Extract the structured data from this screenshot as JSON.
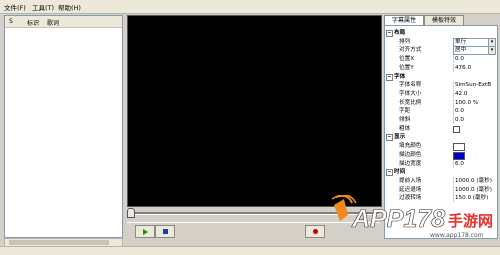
{
  "menu": [
    "文件(F)",
    "工具(T)",
    "帮助(H)"
  ],
  "list": {
    "columns": [
      "S",
      "标识",
      "歌词"
    ]
  },
  "controls": {
    "play": "play",
    "stop": "stop",
    "record": "record"
  },
  "tabs": [
    "字幕属性",
    "模板特效"
  ],
  "properties": [
    {
      "type": "category",
      "name": "布局"
    },
    {
      "type": "select",
      "name": "排列",
      "value": "单行"
    },
    {
      "type": "select",
      "name": "对齐方式",
      "value": "居中"
    },
    {
      "type": "text",
      "name": "位置X",
      "value": "0.0"
    },
    {
      "type": "text",
      "name": "位置Y",
      "value": "476.0"
    },
    {
      "type": "category",
      "name": "字体"
    },
    {
      "type": "text",
      "name": "字体名称",
      "value": "SimSun-ExtB"
    },
    {
      "type": "text",
      "name": "字体大小",
      "value": "42.0"
    },
    {
      "type": "text",
      "name": "长宽比例",
      "value": "100.0 %"
    },
    {
      "type": "text",
      "name": "字距",
      "value": "0.0"
    },
    {
      "type": "text",
      "name": "倾斜",
      "value": "0.0"
    },
    {
      "type": "checkbox",
      "name": "粗体",
      "value": ""
    },
    {
      "type": "category",
      "name": "显示"
    },
    {
      "type": "color",
      "name": "填充颜色",
      "value": "#ffffff"
    },
    {
      "type": "color",
      "name": "描边颜色",
      "value": "#0000cc"
    },
    {
      "type": "text",
      "name": "描边宽度",
      "value": "6.0"
    },
    {
      "type": "category",
      "name": "时间"
    },
    {
      "type": "text",
      "name": "提前入场",
      "value": "1000.0 (毫秒)"
    },
    {
      "type": "text",
      "name": "延迟退场",
      "value": "1000.0 (毫秒)"
    },
    {
      "type": "text",
      "name": "过渡转场",
      "value": "150.0 (毫秒)"
    }
  ],
  "watermark": {
    "brand": "APP178",
    "suffix": "手游网",
    "domain": "www.app178.com"
  },
  "colors": {
    "accent": "#0000cc",
    "watermark_red": "#e8302c"
  }
}
